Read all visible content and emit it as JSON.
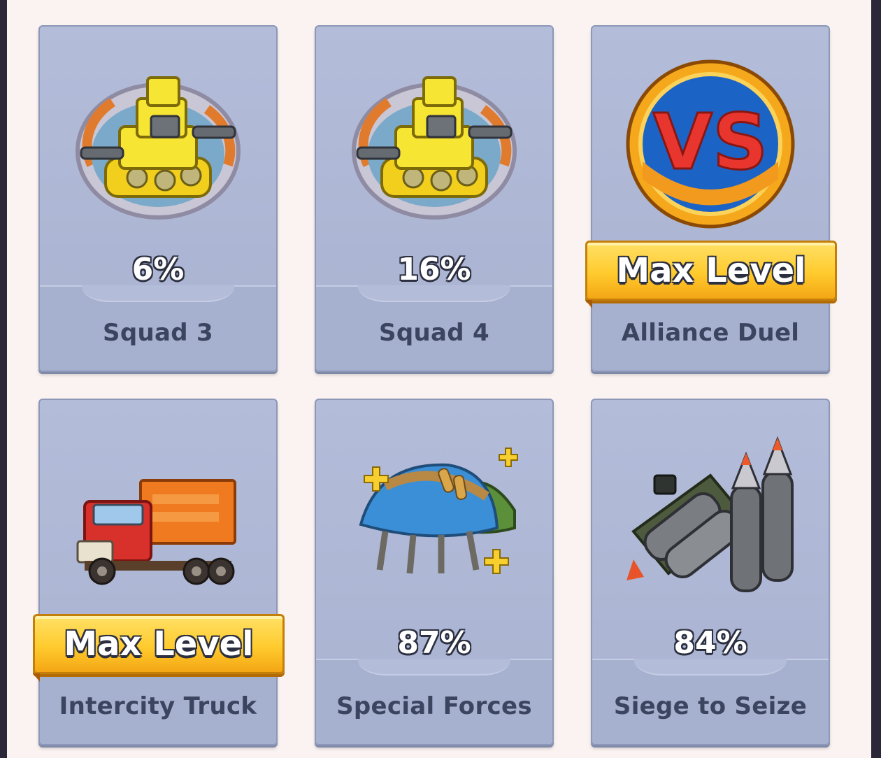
{
  "cards": [
    {
      "name": "Squad 3",
      "progress": "6%",
      "icon": "tank-icon"
    },
    {
      "name": "Squad 4",
      "progress": "16%",
      "icon": "tank-icon"
    },
    {
      "name": "Alliance Duel",
      "badge": "Max Level",
      "icon": "vs-icon"
    },
    {
      "name": "Intercity Truck",
      "badge": "Max Level",
      "icon": "truck-icon"
    },
    {
      "name": "Special Forces",
      "progress": "87%",
      "icon": "helmets-icon"
    },
    {
      "name": "Siege to Seize",
      "progress": "84%",
      "icon": "missiles-icon"
    }
  ],
  "vs_text": "VS"
}
